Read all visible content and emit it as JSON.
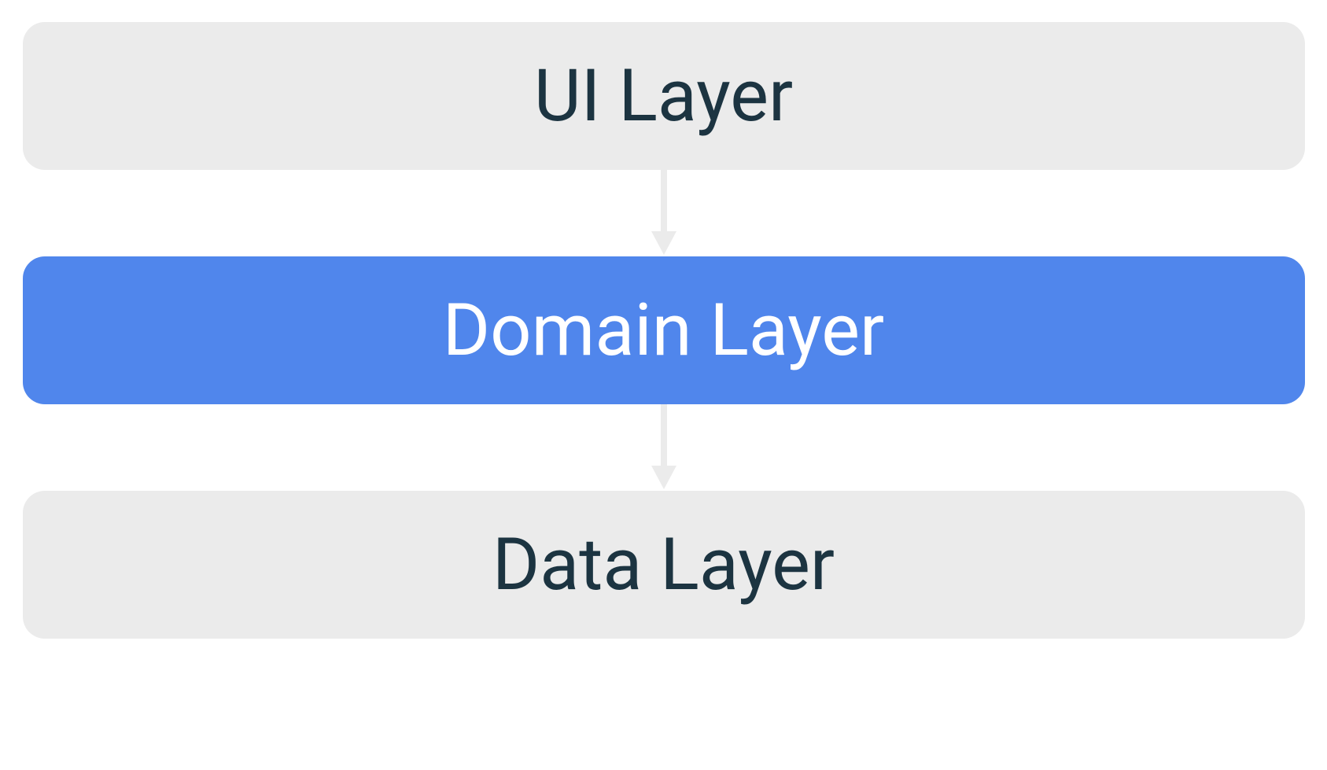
{
  "diagram": {
    "layers": [
      {
        "label": "UI Layer",
        "style": "grey"
      },
      {
        "label": "Domain Layer",
        "style": "blue"
      },
      {
        "label": "Data Layer",
        "style": "grey"
      }
    ],
    "arrow_color": "#ebebeb"
  }
}
